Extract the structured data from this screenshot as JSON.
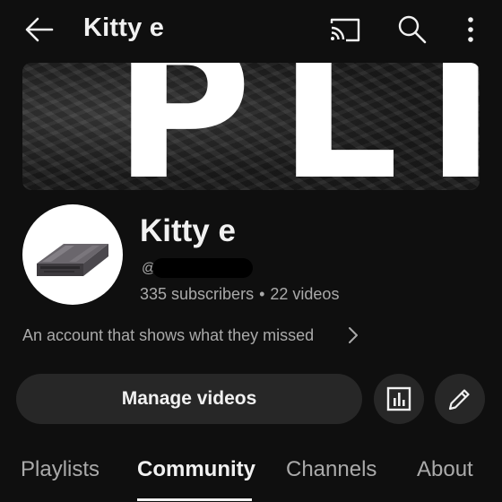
{
  "header": {
    "title": "Kitty e",
    "icons": [
      "back-arrow-icon",
      "cast-icon",
      "search-icon",
      "more-vert-icon"
    ]
  },
  "banner": {
    "text": "PLI"
  },
  "channel": {
    "name": "Kitty e",
    "handle_prefix": "@",
    "subscribers": "335 subscribers",
    "separator": "•",
    "videos": "22 videos",
    "description": "An account that shows what they missed"
  },
  "actions": {
    "manage_label": "Manage videos",
    "analytics_icon": "analytics-icon",
    "edit_icon": "edit-pencil-icon"
  },
  "tabs": [
    {
      "label": "Playlists",
      "active": false
    },
    {
      "label": "Community",
      "active": true
    },
    {
      "label": "Channels",
      "active": false
    },
    {
      "label": "About",
      "active": false
    }
  ],
  "colors": {
    "background": "#0f0f0f",
    "surface": "#272727",
    "text_primary": "#f1f1f1",
    "text_secondary": "#aaaaaa"
  }
}
